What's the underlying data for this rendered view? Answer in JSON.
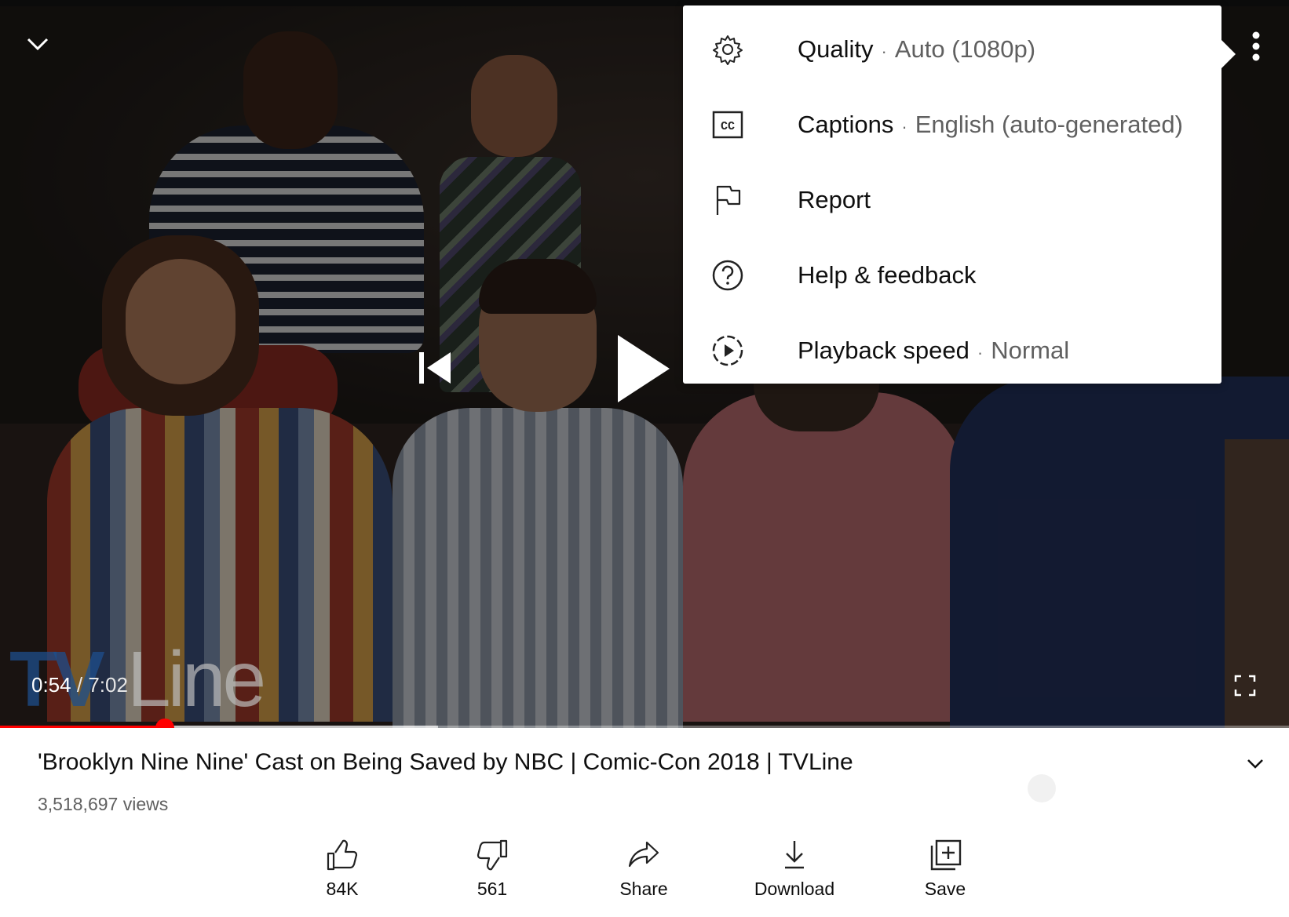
{
  "player": {
    "current_time": "0:54",
    "separator": "/",
    "duration": "7:02",
    "progress_played_fraction": 0.128,
    "progress_buffered_fraction": 0.34,
    "watermark_text": "TVLine"
  },
  "menu": {
    "items": [
      {
        "label": "Quality",
        "value": "Auto (1080p)",
        "icon": "gear-icon"
      },
      {
        "label": "Captions",
        "value": "English (auto-generated)",
        "icon": "closed-captions-icon"
      },
      {
        "label": "Report",
        "value": "",
        "icon": "flag-icon"
      },
      {
        "label": "Help & feedback",
        "value": "",
        "icon": "help-icon"
      },
      {
        "label": "Playback speed",
        "value": "Normal",
        "icon": "playback-speed-icon"
      }
    ],
    "dot": "·"
  },
  "video": {
    "title": "'Brooklyn Nine Nine' Cast on Being Saved by NBC | Comic-Con 2018 | TVLine",
    "views": "3,518,697 views"
  },
  "actions": [
    {
      "label": "84K",
      "icon": "like-icon"
    },
    {
      "label": "561",
      "icon": "dislike-icon"
    },
    {
      "label": "Share",
      "icon": "share-icon"
    },
    {
      "label": "Download",
      "icon": "download-icon"
    },
    {
      "label": "Save",
      "icon": "save-playlist-icon"
    }
  ],
  "colors": {
    "accent": "#ff0000",
    "menu_bg": "#ffffff",
    "text": "#0f0f0f",
    "secondary_text": "#606060"
  }
}
